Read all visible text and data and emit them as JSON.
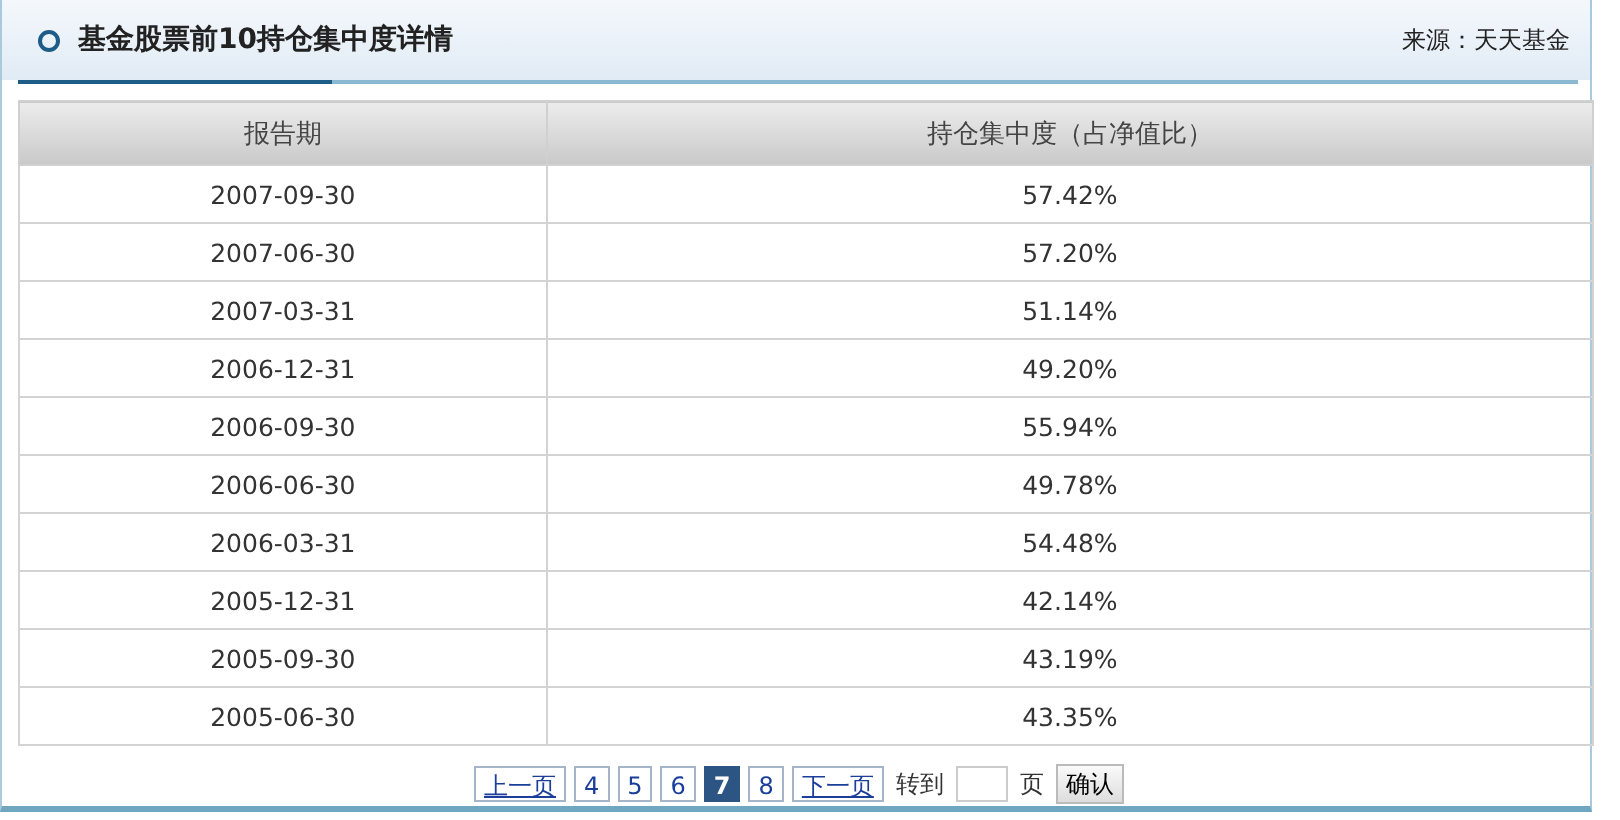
{
  "header": {
    "title": "基金股票前10持仓集中度详情",
    "source": "来源：天天基金"
  },
  "table": {
    "columns": [
      "报告期",
      "持仓集中度（占净值比）"
    ],
    "rows": [
      [
        "2007-09-30",
        "57.42%"
      ],
      [
        "2007-06-30",
        "57.20%"
      ],
      [
        "2007-03-31",
        "51.14%"
      ],
      [
        "2006-12-31",
        "49.20%"
      ],
      [
        "2006-09-30",
        "55.94%"
      ],
      [
        "2006-06-30",
        "49.78%"
      ],
      [
        "2006-03-31",
        "54.48%"
      ],
      [
        "2005-12-31",
        "42.14%"
      ],
      [
        "2005-09-30",
        "43.19%"
      ],
      [
        "2005-06-30",
        "43.35%"
      ]
    ]
  },
  "pagination": {
    "prev": "上一页",
    "pages": [
      {
        "label": "4",
        "selected": false
      },
      {
        "label": "5",
        "selected": false
      },
      {
        "label": "6",
        "selected": false
      },
      {
        "label": "7",
        "selected": true
      },
      {
        "label": "8",
        "selected": false
      }
    ],
    "next": "下一页",
    "goto_label": "转到",
    "page_unit": "页",
    "confirm": "确认"
  }
}
